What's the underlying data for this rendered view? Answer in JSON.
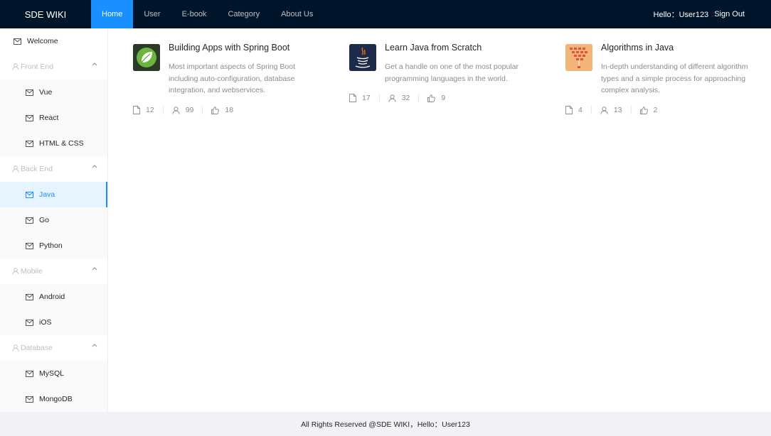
{
  "header": {
    "logo": "SDE WIKI",
    "nav": [
      {
        "label": "Home",
        "active": true
      },
      {
        "label": "User",
        "active": false
      },
      {
        "label": "E-book",
        "active": false
      },
      {
        "label": "Category",
        "active": false
      },
      {
        "label": "About Us",
        "active": false
      }
    ],
    "greeting": "Hello：User123",
    "sign_out": "Sign Out"
  },
  "sidebar": {
    "welcome": "Welcome",
    "groups": [
      {
        "title": "Front End",
        "items": [
          "Vue",
          "React",
          "HTML & CSS"
        ]
      },
      {
        "title": "Back End",
        "items": [
          "Java",
          "Go",
          "Python"
        ],
        "selected": "Java"
      },
      {
        "title": "Mobile",
        "items": [
          "Android",
          "iOS"
        ]
      },
      {
        "title": "Database",
        "items": [
          "MySQL",
          "MongoDB"
        ]
      }
    ]
  },
  "cards": [
    {
      "title": "Building Apps with Spring Boot",
      "description": "Most important aspects of Spring Boot including auto-configuration, database integration, and webservices.",
      "docs": "12",
      "views": "99",
      "likes": "18",
      "icon": "spring-boot-logo"
    },
    {
      "title": "Learn Java from Scratch",
      "description": "Get a handle on one of the most popular programming languages in the world.",
      "docs": "17",
      "views": "32",
      "likes": "9",
      "icon": "java-logo"
    },
    {
      "title": "Algorithms in Java",
      "description": "In-depth understanding of different algorithm types and a simple process for approaching complex analysis.",
      "docs": "4",
      "views": "13",
      "likes": "2",
      "icon": "algorithm-pyramid-logo"
    }
  ],
  "footer": {
    "text": "All Rights Reserved @SDE WIKI，Hello：User123"
  },
  "colors": {
    "header_bg": "#001529",
    "accent": "#1890ff",
    "selected_bg": "#e6f4ff",
    "footer_bg": "#f0f2f5"
  }
}
